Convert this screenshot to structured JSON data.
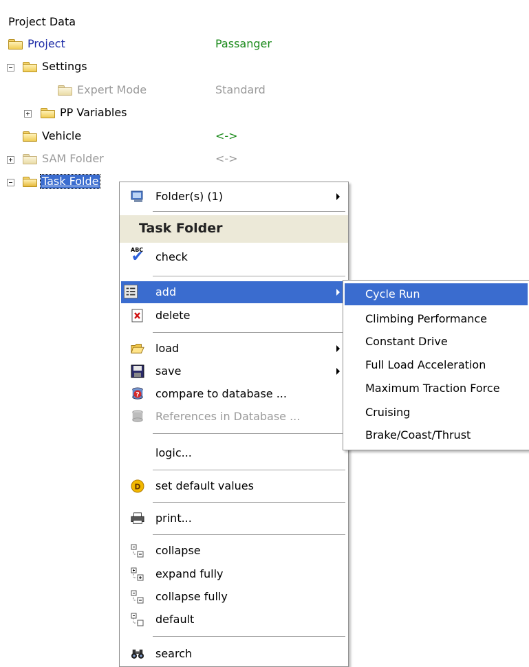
{
  "tree": {
    "header": "Project Data",
    "nodes": [
      {
        "label": "Project",
        "value": "Passanger"
      },
      {
        "label": "Settings"
      },
      {
        "label": "Expert Mode",
        "value": "Standard"
      },
      {
        "label": "PP Variables"
      },
      {
        "label": "Vehicle",
        "value": "<->"
      },
      {
        "label": "SAM Folder",
        "value": "<->"
      },
      {
        "label": "Task Folde"
      }
    ]
  },
  "context_menu": {
    "folders_item": "Folder(s) (1)",
    "section_title": "Task Folder",
    "items": {
      "check": "check",
      "add": "add",
      "delete": "delete",
      "load": "load",
      "save": "save",
      "compare": "compare to database ...",
      "references": "References in Database ...",
      "logic": "logic...",
      "set_default": "set default values",
      "print": "print...",
      "collapse": "collapse",
      "expand_fully": "expand fully",
      "collapse_fully": "collapse fully",
      "default": "default",
      "search": "search"
    }
  },
  "submenu": {
    "items": [
      "Cycle Run",
      "Climbing Performance",
      "Constant Drive",
      "Full Load Acceleration",
      "Maximum Traction Force",
      "Cruising",
      "Brake/Coast/Thrust"
    ]
  },
  "colors": {
    "highlight": "#3a6ccf",
    "project_blue": "#1f2ea8",
    "value_green": "#1a8a1a",
    "disabled_gray": "#9a9a9a"
  }
}
